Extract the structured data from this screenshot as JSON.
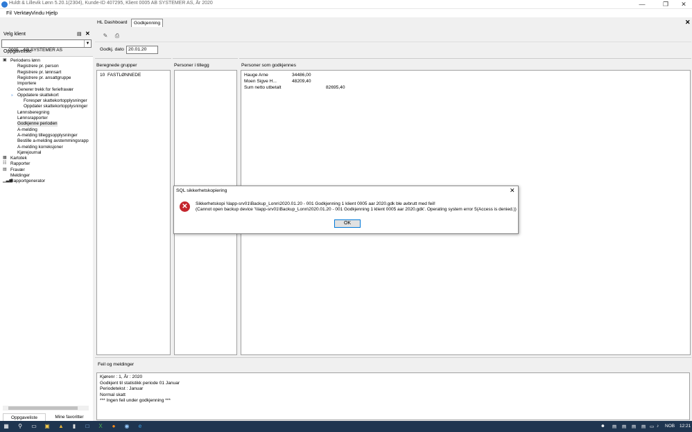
{
  "window": {
    "title": "Huldt & Lillevik Lønn 5.20.1(2304), Kunde-ID 407295, Klient 0005 AB SYSTEMER AS, År 2020"
  },
  "menu": [
    "Fil",
    "Verktøy",
    "Vindu",
    "Hjelp"
  ],
  "left": {
    "header": "Velg klient",
    "client": "0005    AB SYSTEMER AS",
    "list_title": "Oppgaveliste",
    "tree": [
      {
        "label": "Periodens lønn",
        "level": 0,
        "icon": "folder-icon"
      },
      {
        "label": "Registrere pr. person",
        "level": 1
      },
      {
        "label": "Registrere pr. lønnsart",
        "level": 1
      },
      {
        "label": "Registrere pr. ansattgruppe",
        "level": 1
      },
      {
        "label": "Importere",
        "level": 1
      },
      {
        "label": "Generer trekk for feriefravær",
        "level": 1
      },
      {
        "label": "Oppdatere skattekort",
        "level": 1,
        "expander": true
      },
      {
        "label": "Forespør skattekortopplysninger",
        "level": 2
      },
      {
        "label": "Oppdater skattekortopplysninger",
        "level": 2
      },
      {
        "label": "Lønnsberegning",
        "level": 1
      },
      {
        "label": "Lønnsrapporter",
        "level": 1
      },
      {
        "label": "Godkjenne perioden",
        "level": 1,
        "selected": true
      },
      {
        "label": "A-melding",
        "level": 1
      },
      {
        "label": "A-melding tilleggsopplysninger",
        "level": 1
      },
      {
        "label": "Bestille a-melding avstemmingsrapp",
        "level": 1
      },
      {
        "label": "A-melding korreksjoner",
        "level": 1
      },
      {
        "label": "Kjørejournal",
        "level": 1
      },
      {
        "label": "Kartotek",
        "level": 0,
        "icon": "cards-icon"
      },
      {
        "label": "Rapporter",
        "level": 0,
        "icon": "report-icon"
      },
      {
        "label": "Fravær",
        "level": 0,
        "icon": "calendar-icon"
      },
      {
        "label": "Meldinger",
        "level": 0
      },
      {
        "label": "Rapportgenerator",
        "level": 0,
        "icon": "bar-chart-icon"
      }
    ],
    "bottom_tabs": [
      "Oppgaveliste",
      "Mine favoritter"
    ]
  },
  "tabs": [
    "HL Dashboard",
    "Godkjenning"
  ],
  "form": {
    "date_label": "Godkj. dato",
    "date_value": "20.01.20"
  },
  "panels": {
    "groups": {
      "title": "Beregnede grupper",
      "items": [
        {
          "code": "10",
          "name": "FASTLØNNEDE"
        }
      ]
    },
    "extra": {
      "title": "Personer i tillegg"
    },
    "persons": {
      "title": "Personer som godkjennes",
      "rows": [
        {
          "name": "Hauge Arne",
          "amount": "34486,00"
        },
        {
          "name": "Moen Sigve H...",
          "amount": "48209,40"
        }
      ],
      "sum_label": "Sum netto utbetalt",
      "sum_value": "82695,40"
    },
    "errors": {
      "title": "Feil og meldinger",
      "lines": [
        "Kjørenr : 1, År : 2020",
        "Godkjent til statistikk periode 01 Januar",
        "Periodetekst : Januar",
        "Normal skatt",
        "*** Ingen feil under godkjenning ***"
      ]
    }
  },
  "dialog": {
    "title": "SQL sikkerhetskopiering",
    "line1": "Sikkerhetskopi \\\\lapp-srv01\\Backup_Lonn\\2020.01.20 - 001 Godkjenning 1 klient 0005 aar 2020.gdk ble avbrutt med feil!",
    "line2": "(Cannot open backup device '\\\\lapp-srv01\\Backup_Lonn\\2020.01.20 - 001 Godkjenning 1 klient 0005 aar 2020.gdk'. Operating system error 5(Access is denied.))",
    "ok": "OK"
  },
  "taskbar": {
    "language": "NOB",
    "time": "12:21"
  },
  "colors": {
    "error": "#c4262e",
    "accent": "#0078d7",
    "taskbar": "#1f3550"
  }
}
